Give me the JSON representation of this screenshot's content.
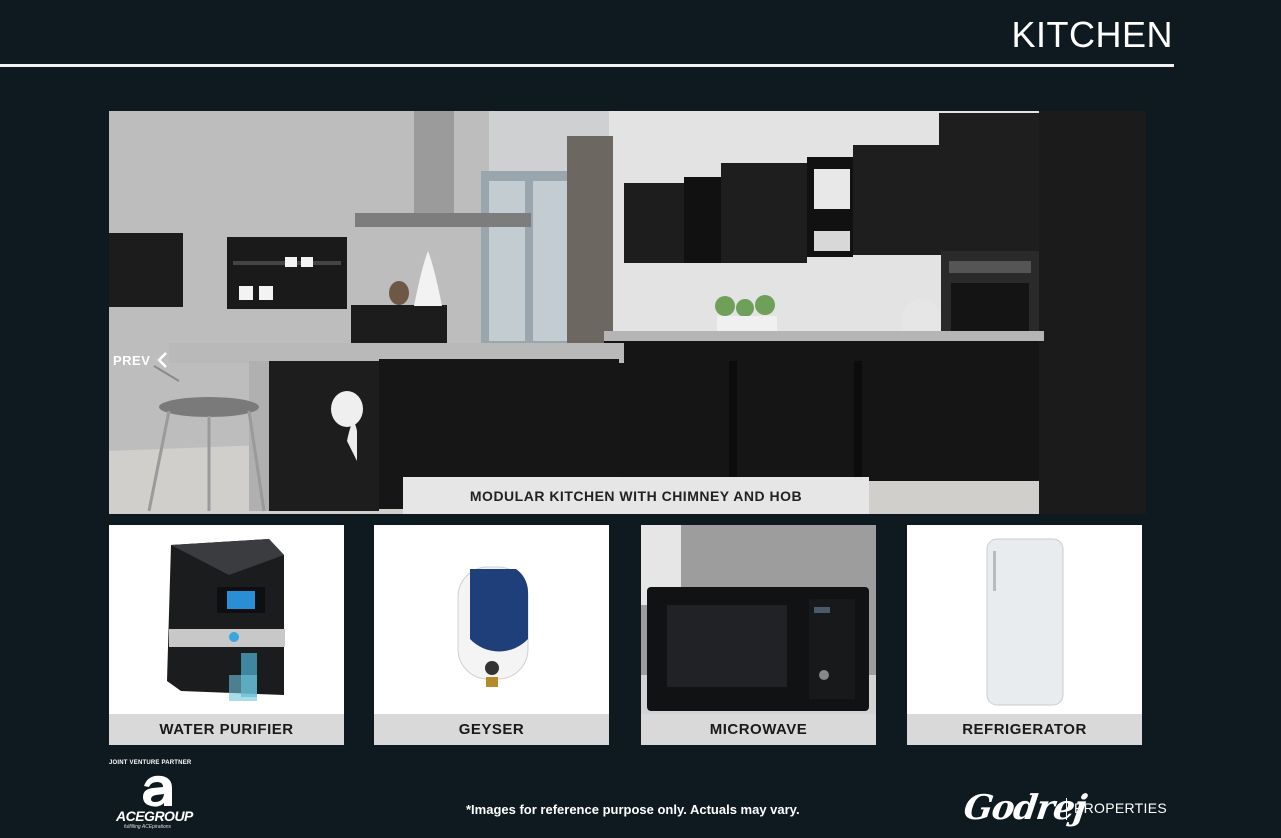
{
  "header": {
    "title": "KITCHEN"
  },
  "hero": {
    "prev_label": "PREV",
    "caption": "MODULAR KITCHEN WITH CHIMNEY AND HOB"
  },
  "features": [
    {
      "label": "WATER PURIFIER",
      "icon": "water-purifier-image"
    },
    {
      "label": "GEYSER",
      "icon": "geyser-image"
    },
    {
      "label": "MICROWAVE",
      "icon": "microwave-image"
    },
    {
      "label": "REFRIGERATOR",
      "icon": "refrigerator-image"
    }
  ],
  "footer": {
    "jv_label": "JOINT VENTURE PARTNER",
    "ace_logo_text": "ACEGROUP",
    "ace_tagline": "fulfilling ACEpirations",
    "disclaimer": "*Images for reference purpose only. Actuals may vary.",
    "godrej_logo_text": "Godrej",
    "properties_label": "PROPERTIES"
  },
  "colors": {
    "background": "#0f1a20",
    "caption_bg": "#d9d9d9",
    "text_light": "#ffffff"
  }
}
